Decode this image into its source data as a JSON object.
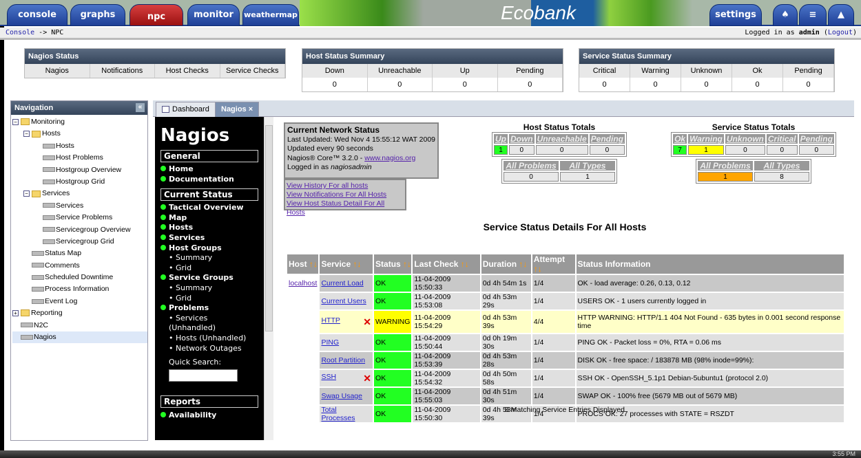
{
  "top_tabs": [
    "console",
    "graphs",
    "npc",
    "monitor",
    "weathermap"
  ],
  "settings_label": "settings",
  "logo_text": "Ecobank",
  "breadcrumb": {
    "link": "Console",
    "rest": " -> NPC"
  },
  "login": {
    "prefix": "Logged in as ",
    "user": "admin",
    "logout": "Logout"
  },
  "nagios_status": {
    "title": "Nagios Status",
    "cols": [
      "Nagios",
      "Notifications",
      "Host Checks",
      "Service Checks"
    ]
  },
  "host_summary": {
    "title": "Host Status Summary",
    "cols": [
      "Down",
      "Unreachable",
      "Up",
      "Pending"
    ],
    "values": [
      "0",
      "0",
      "0",
      "0"
    ]
  },
  "service_summary": {
    "title": "Service Status Summary",
    "cols": [
      "Critical",
      "Warning",
      "Unknown",
      "Ok",
      "Pending"
    ],
    "values": [
      "0",
      "0",
      "0",
      "0",
      "0"
    ]
  },
  "navigation": {
    "title": "Navigation",
    "items": [
      {
        "label": "Monitoring",
        "level": 0,
        "type": "folder"
      },
      {
        "label": "Hosts",
        "level": 1,
        "type": "folder"
      },
      {
        "label": "Hosts",
        "level": 2,
        "type": "leaf"
      },
      {
        "label": "Host Problems",
        "level": 2,
        "type": "leaf"
      },
      {
        "label": "Hostgroup Overview",
        "level": 2,
        "type": "leaf"
      },
      {
        "label": "Hostgroup Grid",
        "level": 2,
        "type": "leaf"
      },
      {
        "label": "Services",
        "level": 1,
        "type": "folder"
      },
      {
        "label": "Services",
        "level": 2,
        "type": "leaf"
      },
      {
        "label": "Service Problems",
        "level": 2,
        "type": "leaf"
      },
      {
        "label": "Servicegroup Overview",
        "level": 2,
        "type": "leaf"
      },
      {
        "label": "Servicegroup Grid",
        "level": 2,
        "type": "leaf"
      },
      {
        "label": "Status Map",
        "level": 1,
        "type": "leaf"
      },
      {
        "label": "Comments",
        "level": 1,
        "type": "leaf"
      },
      {
        "label": "Scheduled Downtime",
        "level": 1,
        "type": "leaf"
      },
      {
        "label": "Process Information",
        "level": 1,
        "type": "leaf"
      },
      {
        "label": "Event Log",
        "level": 1,
        "type": "leaf"
      },
      {
        "label": "Reporting",
        "level": 0,
        "type": "folder-plus"
      },
      {
        "label": "N2C",
        "level": 0,
        "type": "leaf"
      },
      {
        "label": "Nagios",
        "level": 0,
        "type": "leaf",
        "selected": true
      }
    ]
  },
  "content_tabs": [
    "Dashboard",
    "Nagios"
  ],
  "sidebar": {
    "logo": "Nagios",
    "sections": [
      {
        "title": "General",
        "items": [
          {
            "t": "Home",
            "k": "i"
          },
          {
            "t": "Documentation",
            "k": "i"
          }
        ]
      },
      {
        "title": "Current Status",
        "items": [
          {
            "t": "Tactical Overview",
            "k": "i"
          },
          {
            "t": "Map",
            "k": "i"
          },
          {
            "t": "Hosts",
            "k": "i"
          },
          {
            "t": "Services",
            "k": "i"
          },
          {
            "t": "Host Groups",
            "k": "i"
          },
          {
            "t": "• Summary",
            "k": "s"
          },
          {
            "t": "• Grid",
            "k": "s"
          },
          {
            "t": "Service Groups",
            "k": "i"
          },
          {
            "t": "• Summary",
            "k": "s"
          },
          {
            "t": "• Grid",
            "k": "s"
          },
          {
            "t": "Problems",
            "k": "i"
          },
          {
            "t": "• Services",
            "k": "s"
          },
          {
            "t": "(Unhandled)",
            "k": "s"
          },
          {
            "t": "• Hosts (Unhandled)",
            "k": "s"
          },
          {
            "t": "• Network Outages",
            "k": "s"
          }
        ]
      }
    ],
    "quick_search": "Quick Search:",
    "reports": {
      "title": "Reports",
      "items": [
        "Availability"
      ]
    }
  },
  "network_status": {
    "title": "Current Network Status",
    "updated": "Last Updated: Wed Nov 4 15:55:12 WAT 2009",
    "interval": "Updated every 90 seconds",
    "version": "Nagios® Core™ 3.2.0 - ",
    "site": "www.nagios.org",
    "logged": "Logged in as ",
    "user": "nagiosadmin"
  },
  "links": [
    "View History For all hosts",
    "View Notifications For All Hosts",
    "View Host Status Detail For All Hosts"
  ],
  "host_totals": {
    "title": "Host Status Totals",
    "cols": [
      "Up",
      "Down",
      "Unreachable",
      "Pending"
    ],
    "values": [
      "1",
      "0",
      "0",
      "0"
    ],
    "cols2": [
      "All Problems",
      "All Types"
    ],
    "values2": [
      "0",
      "1"
    ]
  },
  "service_totals": {
    "title": "Service Status Totals",
    "cols": [
      "Ok",
      "Warning",
      "Unknown",
      "Critical",
      "Pending"
    ],
    "values": [
      "7",
      "1",
      "0",
      "0",
      "0"
    ],
    "cols2": [
      "All Problems",
      "All Types"
    ],
    "values2": [
      "1",
      "8"
    ]
  },
  "details_title": "Service Status Details For All Hosts",
  "table": {
    "headers": [
      "Host",
      "Service",
      "Status",
      "Last Check",
      "Duration",
      "Attempt",
      "Status Information"
    ],
    "rows": [
      {
        "host": "localhost",
        "service": "Current Load",
        "status": "OK",
        "last": "11-04-2009 15:50:33",
        "dur": "0d 4h 54m 1s",
        "att": "1/4",
        "info": "OK - load average: 0.26, 0.13, 0.12"
      },
      {
        "host": "",
        "service": "Current Users",
        "status": "OK",
        "last": "11-04-2009 15:53:08",
        "dur": "0d 4h 53m 29s",
        "att": "1/4",
        "info": "USERS OK - 1 users currently logged in"
      },
      {
        "host": "",
        "service": "HTTP",
        "status": "WARNING",
        "last": "11-04-2009 15:54:29",
        "dur": "0d 4h 53m 39s",
        "att": "4/4",
        "info": "HTTP WARNING: HTTP/1.1 404 Not Found - 635 bytes in 0.001 second response time",
        "muted": true
      },
      {
        "host": "",
        "service": "PING",
        "status": "OK",
        "last": "11-04-2009 15:50:44",
        "dur": "0d 0h 19m 30s",
        "att": "1/4",
        "info": "PING OK - Packet loss = 0%, RTA = 0.06 ms"
      },
      {
        "host": "",
        "service": "Root Partition",
        "status": "OK",
        "last": "11-04-2009 15:53:39",
        "dur": "0d 4h 53m 28s",
        "att": "1/4",
        "info": "DISK OK - free space: / 183878 MB (98% inode=99%):"
      },
      {
        "host": "",
        "service": "SSH",
        "status": "OK",
        "last": "11-04-2009 15:54:32",
        "dur": "0d 4h 50m 58s",
        "att": "1/4",
        "info": "SSH OK - OpenSSH_5.1p1 Debian-5ubuntu1 (protocol 2.0)",
        "muted": true
      },
      {
        "host": "",
        "service": "Swap Usage",
        "status": "OK",
        "last": "11-04-2009 15:55:03",
        "dur": "0d 4h 51m 30s",
        "att": "1/4",
        "info": "SWAP OK - 100% free (5679 MB out of 5679 MB)"
      },
      {
        "host": "",
        "service": "Total Processes",
        "status": "OK",
        "last": "11-04-2009 15:50:30",
        "dur": "0d 4h 53m 39s",
        "att": "1/4",
        "info": "PROCS OK: 27 processes with STATE = RSZDT"
      }
    ]
  },
  "footer": "8 Matching Service Entries Displayed",
  "clock": "3:55 PM",
  "colors": {
    "ok": "#22ff22",
    "warning": "#ffff00",
    "problem": "#ffa500"
  }
}
